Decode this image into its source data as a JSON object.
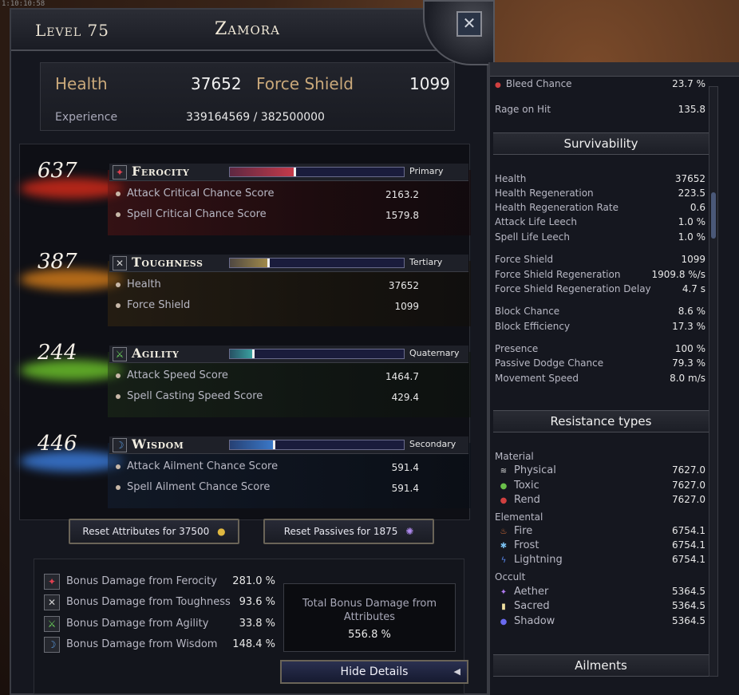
{
  "top_strip": "1:10:10:58",
  "header": {
    "level": "Level 75",
    "name": "Zamora",
    "close_icon": "close-icon"
  },
  "stats": {
    "health_label": "Health",
    "health_value": "37652",
    "force_shield_label": "Force Shield",
    "force_shield_value": "1099",
    "experience_label": "Experience",
    "experience_value": "339164569  /  382500000"
  },
  "attributes": [
    {
      "value": "637",
      "name": "Ferocity",
      "rank": "Primary",
      "fill": 0.38,
      "color": "#c43a4a",
      "subs": [
        {
          "label": "Attack Critical Chance Score",
          "value": "2163.2"
        },
        {
          "label": "Spell Critical Chance Score",
          "value": "1579.8"
        }
      ]
    },
    {
      "value": "387",
      "name": "Toughness",
      "rank": "Tertiary",
      "fill": 0.23,
      "color": "#a08a4a",
      "subs": [
        {
          "label": "Health",
          "value": "37652"
        },
        {
          "label": "Force Shield",
          "value": "1099"
        }
      ]
    },
    {
      "value": "244",
      "name": "Agility",
      "rank": "Quaternary",
      "fill": 0.14,
      "color": "#3aa0a0",
      "subs": [
        {
          "label": "Attack Speed Score",
          "value": "1464.7"
        },
        {
          "label": "Spell Casting Speed Score",
          "value": "429.4"
        }
      ]
    },
    {
      "value": "446",
      "name": "Wisdom",
      "rank": "Secondary",
      "fill": 0.26,
      "color": "#3a78c8",
      "subs": [
        {
          "label": "Attack Ailment Chance Score",
          "value": "591.4"
        },
        {
          "label": "Spell Ailment Chance Score",
          "value": "591.4"
        }
      ]
    }
  ],
  "buttons": {
    "reset_attributes": "Reset Attributes for 37500",
    "reset_passives": "Reset Passives for 1875",
    "hide_details": "Hide Details"
  },
  "bonus": {
    "rows": [
      {
        "label": "Bonus Damage from Ferocity",
        "value": "281.0 %"
      },
      {
        "label": "Bonus Damage from Toughness",
        "value": "93.6 %"
      },
      {
        "label": "Bonus Damage from Agility",
        "value": "33.8 %"
      },
      {
        "label": "Bonus Damage from Wisdom",
        "value": "148.4 %"
      }
    ],
    "total_label": "Total Bonus Damage from Attributes",
    "total_value": "556.8 %"
  },
  "right": {
    "top_lines": [
      {
        "label": "Bleed Chance",
        "value": "23.7 %"
      },
      {
        "label": "Rage on Hit",
        "value": "135.8"
      }
    ],
    "survivability_title": "Survivability",
    "survivability": [
      {
        "label": "Health",
        "value": "37652"
      },
      {
        "label": "Health Regeneration",
        "value": "223.5"
      },
      {
        "label": "Health Regeneration Rate",
        "value": "0.6"
      },
      {
        "label": "Attack Life Leech",
        "value": "1.0 %"
      },
      {
        "label": "Spell Life Leech",
        "value": "1.0 %"
      },
      {
        "label": "Force Shield",
        "value": "1099"
      },
      {
        "label": "Force Shield Regeneration",
        "value": "1909.8 %/s"
      },
      {
        "label": "Force Shield Regeneration Delay",
        "value": "4.7 s"
      },
      {
        "label": "Block Chance",
        "value": "8.6 %"
      },
      {
        "label": "Block Efficiency",
        "value": "17.3 %"
      },
      {
        "label": "Presence",
        "value": "100 %"
      },
      {
        "label": "Passive Dodge Chance",
        "value": "79.3 %"
      },
      {
        "label": "Movement Speed",
        "value": "8.0 m/s"
      }
    ],
    "resistance_title": "Resistance types",
    "material_label": "Material",
    "material": [
      {
        "label": "Physical",
        "value": "7627.0",
        "icon": "claw-icon",
        "color": "#d8d8d8"
      },
      {
        "label": "Toxic",
        "value": "7627.0",
        "icon": "drop-icon",
        "color": "#6ac04a"
      },
      {
        "label": "Rend",
        "value": "7627.0",
        "icon": "blood-icon",
        "color": "#d04040"
      }
    ],
    "elemental_label": "Elemental",
    "elemental": [
      {
        "label": "Fire",
        "value": "6754.1",
        "icon": "flame-icon",
        "color": "#f07a3a"
      },
      {
        "label": "Frost",
        "value": "6754.1",
        "icon": "snowflake-icon",
        "color": "#7ac0f0"
      },
      {
        "label": "Lightning",
        "value": "6754.1",
        "icon": "bolt-icon",
        "color": "#5a8af0"
      }
    ],
    "occult_label": "Occult",
    "occult": [
      {
        "label": "Aether",
        "value": "5364.5",
        "icon": "aether-icon",
        "color": "#b07af0"
      },
      {
        "label": "Sacred",
        "value": "5364.5",
        "icon": "candle-icon",
        "color": "#f0e0a0"
      },
      {
        "label": "Shadow",
        "value": "5364.5",
        "icon": "orb-icon",
        "color": "#6a6af0"
      }
    ],
    "ailments_title": "Ailments"
  }
}
